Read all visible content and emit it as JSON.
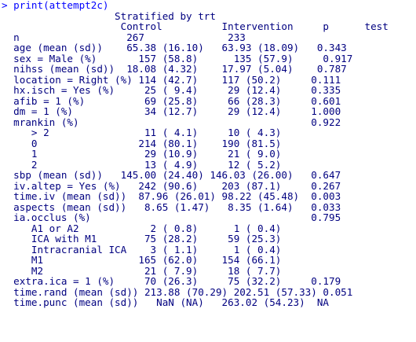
{
  "console": {
    "prompt": "> ",
    "command": "print(attempt2c)",
    "output_lines": [
      "                   Stratified by trt",
      "                    Control          Intervention     p      test",
      "  n                  267              233",
      "  age (mean (sd))    65.38 (16.10)   63.93 (18.09)   0.343",
      "  sex = Male (%)       157 (58.8)      135 (57.9)     0.917",
      "  nihss (mean (sd))  18.08 (4.32)    17.97 (5.04)    0.787",
      "  location = Right (%) 114 (42.7)    117 (50.2)     0.111",
      "  hx.isch = Yes (%)     25 ( 9.4)     29 (12.4)     0.335",
      "  afib = 1 (%)          69 (25.8)     66 (28.3)     0.601",
      "  dm = 1 (%)            34 (12.7)     29 (12.4)     1.000",
      "  mrankin (%)                                       0.922",
      "     > 2                11 ( 4.1)     10 ( 4.3)",
      "     0                 214 (80.1)    190 (81.5)",
      "     1                  29 (10.9)     21 ( 9.0)",
      "     2                  13 ( 4.9)     12 ( 5.2)",
      "  sbp (mean (sd))   145.00 (24.40) 146.03 (26.00)   0.647",
      "  iv.altep = Yes (%)   242 (90.6)    203 (87.1)     0.267",
      "  time.iv (mean (sd))  87.96 (26.01) 98.22 (45.48)  0.003",
      "  aspects (mean (sd))   8.65 (1.47)   8.35 (1.64)   0.033",
      "  ia.occlus (%)                                     0.795",
      "     A1 or A2            2 ( 0.8)      1 ( 0.4)",
      "     ICA with M1        75 (28.2)     59 (25.3)",
      "     Intracranial ICA    3 ( 1.1)      1 ( 0.4)",
      "     M1                165 (62.0)    154 (66.1)",
      "     M2                 21 ( 7.9)     18 ( 7.7)",
      "  extra.ica = 1 (%)     70 (26.3)     75 (32.2)     0.179",
      "  time.rand (mean (sd)) 213.88 (70.29) 202.51 (57.33) 0.051",
      "  time.punc (mean (sd))   NaN (NA)   263.02 (54.23)  NA"
    ]
  }
}
